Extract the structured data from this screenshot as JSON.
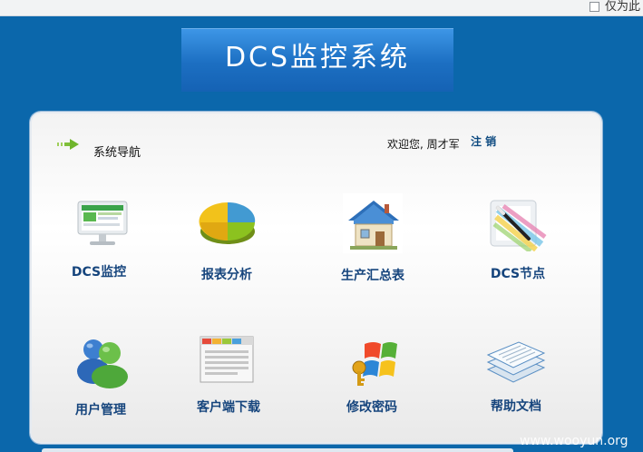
{
  "topbar": {
    "checkbox_label": "仅为此"
  },
  "banner": {
    "title": "DCS监控系统"
  },
  "nav": {
    "label": "系统导航"
  },
  "user": {
    "welcome": "欢迎您, 周才军",
    "logout": "注 销"
  },
  "tiles": [
    {
      "label": "DCS监控",
      "icon": "monitor-icon"
    },
    {
      "label": "报表分析",
      "icon": "pie-chart-icon"
    },
    {
      "label": "生产汇总表",
      "icon": "house-icon"
    },
    {
      "label": "DCS节点",
      "icon": "magic-wand-icon"
    },
    {
      "label": "用户管理",
      "icon": "users-icon"
    },
    {
      "label": "客户端下载",
      "icon": "browser-window-icon"
    },
    {
      "label": "修改密码",
      "icon": "windows-key-icon"
    },
    {
      "label": "帮助文档",
      "icon": "documents-icon"
    }
  ],
  "watermark": "www.wooyun.org",
  "colors": {
    "background": "#0b67ab",
    "banner": "#1c6fc2",
    "label": "#16457d"
  }
}
